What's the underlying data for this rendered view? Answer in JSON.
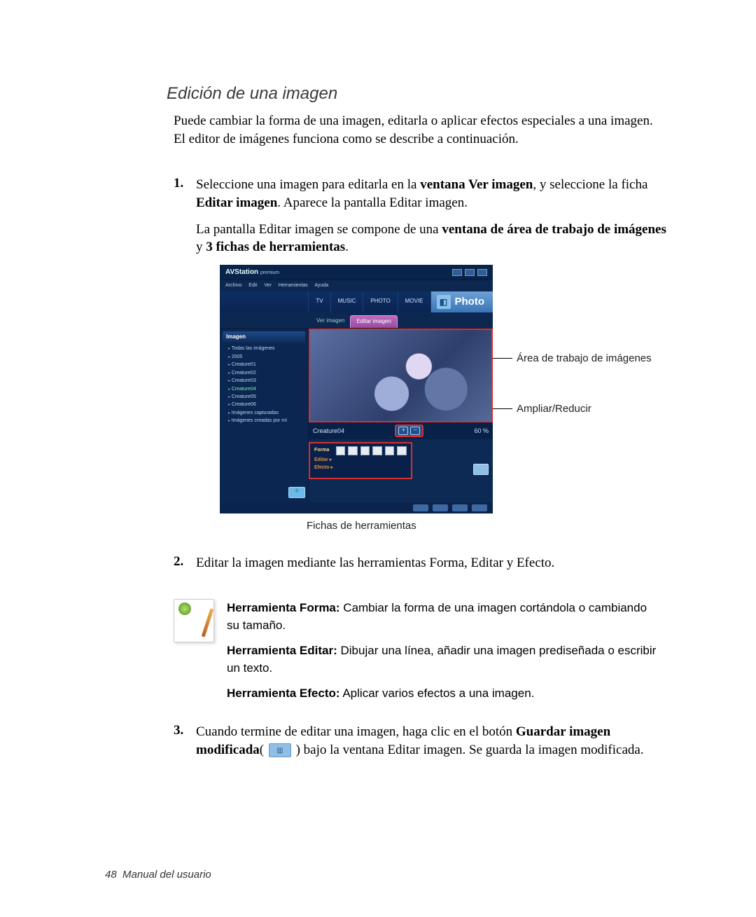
{
  "title": "Edición de una imagen",
  "intro": "Puede cambiar la forma de una imagen, editarla o aplicar efectos especiales a una imagen. El editor de imágenes funciona como se describe a continuación.",
  "steps": {
    "s1": {
      "num": "1.",
      "p1a": "Seleccione una imagen para editarla en la ",
      "p1b": "ventana Ver imagen",
      "p1c": ", y seleccione la ficha ",
      "p1d": "Editar imagen",
      "p1e": ". Aparece la pantalla Editar imagen.",
      "p2a": "La pantalla Editar imagen se compone de una ",
      "p2b": "ventana de área de trabajo de imágenes",
      "p2c": " y ",
      "p2d": "3 fichas de herramientas",
      "p2e": "."
    },
    "s2": {
      "num": "2.",
      "text": "Editar la imagen mediante las herramientas Forma, Editar y Efecto."
    },
    "s3": {
      "num": "3.",
      "a": "Cuando termine de editar una imagen, haga clic en el botón ",
      "b": "Guardar imagen modificada",
      "c": "( ",
      "d": " ) bajo la ventana Editar imagen. Se guarda la imagen modificada."
    }
  },
  "note": {
    "forma_label": "Herramienta Forma:",
    "forma_text": " Cambiar la forma de una imagen cortándola o cambiando su tamaño.",
    "editar_label": "Herramienta Editar:",
    "editar_text": " Dibujar una línea, añadir una imagen prediseñada o escribir un texto.",
    "efecto_label": "Herramienta Efecto:",
    "efecto_text": " Aplicar varios efectos a una imagen."
  },
  "figure": {
    "app_title": "AVStation",
    "app_sub": "premium",
    "menus": [
      "Archivo",
      "Edit",
      "Ver",
      "Herramientas",
      "Ayuda"
    ],
    "tabs": [
      "TV",
      "MUSIC",
      "PHOTO",
      "MOVIE"
    ],
    "big_tab": "Photo",
    "subtabs": {
      "inactive": "Ver imagen",
      "active": "Editar imagen"
    },
    "sidebar_header": "Imagen",
    "sidebar_items": [
      "Todas las imágenes",
      "2005",
      "Creature01",
      "Creature02",
      "Creature03",
      "Creature04",
      "Creature05",
      "Creature06",
      "Imágenes capturadas",
      "Imágenes creadas por mí"
    ],
    "status_filename": "Creature04",
    "status_zoom": "60 %",
    "tool_labels": [
      "Forma",
      "Editar ▸",
      "Efecto ▸"
    ],
    "callout_workarea": "Área de trabajo de imágenes",
    "callout_zoom": "Ampliar/Reducir",
    "caption_tools": "Fichas de herramientas"
  },
  "footer": {
    "page": "48",
    "label": "Manual del usuario"
  }
}
